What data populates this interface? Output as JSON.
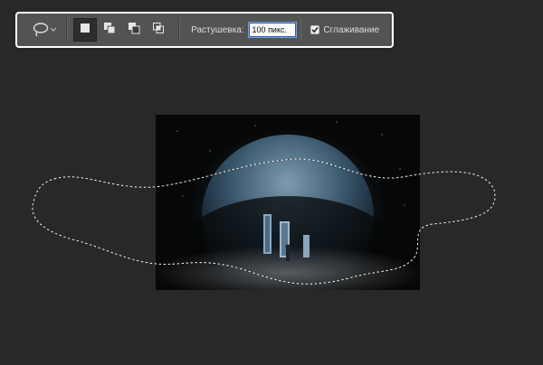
{
  "options_bar": {
    "tool_icon": "lasso-icon",
    "dropdown_icon": "chevron-down-icon",
    "selection_modes": [
      {
        "name": "new-selection",
        "active": true
      },
      {
        "name": "add-to-selection",
        "active": false
      },
      {
        "name": "subtract-from-selection",
        "active": false
      },
      {
        "name": "intersect-with-selection",
        "active": false
      }
    ],
    "feather_label": "Растушевка:",
    "feather_value": "100 пикс.",
    "antialias_checked": true,
    "antialias_label": "Сглаживание"
  },
  "colors": {
    "workspace_bg": "#282828",
    "options_bar_bg": "#535353",
    "highlight_border": "#ffffff",
    "input_focus": "#2a5ea8"
  }
}
